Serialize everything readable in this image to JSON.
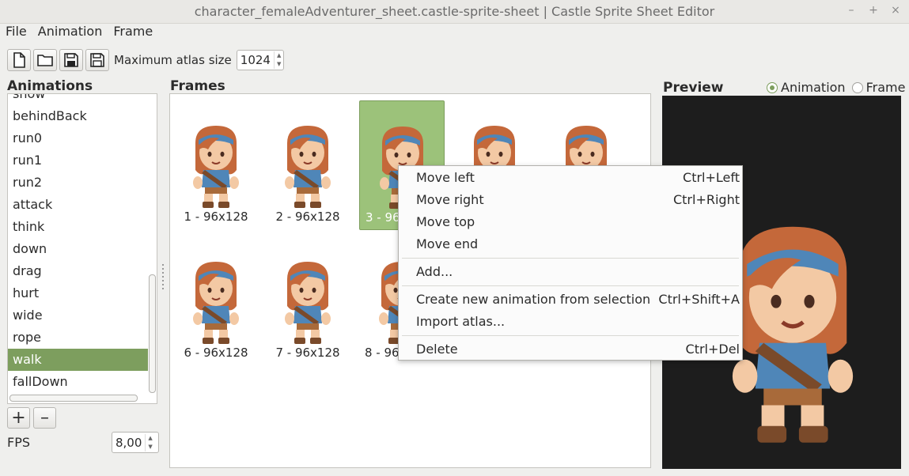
{
  "window": {
    "title": "character_femaleAdventurer_sheet.castle-sprite-sheet | Castle Sprite Sheet Editor",
    "controls": [
      "–",
      "+",
      "×"
    ]
  },
  "menubar": [
    {
      "label": "File"
    },
    {
      "label": "Animation"
    },
    {
      "label": "Frame"
    }
  ],
  "toolbar": {
    "buttons": [
      "new-file-icon",
      "open-folder-icon",
      "save-icon",
      "save-as-icon"
    ],
    "atlas_label": "Maximum atlas size",
    "atlas_value": "1024"
  },
  "animations": {
    "title": "Animations",
    "items": [
      "show",
      "behindBack",
      "run0",
      "run1",
      "run2",
      "attack",
      "think",
      "down",
      "drag",
      "hurt",
      "wide",
      "rope",
      "walk",
      "fallDown"
    ],
    "selected": "walk",
    "add_label": "+",
    "remove_label": "–"
  },
  "fps": {
    "label": "FPS",
    "value": "8,00"
  },
  "frames": {
    "title": "Frames",
    "items": [
      {
        "label": "1 - 96x128"
      },
      {
        "label": "2 - 96x128"
      },
      {
        "label": "3 - 96"
      },
      {
        "label": ""
      },
      {
        "label": ""
      },
      {
        "label": "6 - 96x128"
      },
      {
        "label": "7 - 96x128"
      },
      {
        "label": "8 - 96"
      }
    ],
    "selected_index": 2
  },
  "preview": {
    "title": "Preview",
    "mode_animation": "Animation",
    "mode_frame": "Frame",
    "selected_mode": "Animation"
  },
  "context_menu": {
    "move_left": {
      "label": "Move left",
      "shortcut": "Ctrl+Left"
    },
    "move_right": {
      "label": "Move right",
      "shortcut": "Ctrl+Right"
    },
    "move_top": {
      "label": "Move top",
      "shortcut": ""
    },
    "move_end": {
      "label": "Move end",
      "shortcut": ""
    },
    "add": {
      "label": "Add...",
      "shortcut": ""
    },
    "create_anim": {
      "label": "Create new animation from selection",
      "shortcut": "Ctrl+Shift+A"
    },
    "import_atlas": {
      "label": "Import atlas...",
      "shortcut": ""
    },
    "delete": {
      "label": "Delete",
      "shortcut": "Ctrl+Del"
    }
  },
  "colors": {
    "selection": "#7d9e5e",
    "frame_selection": "#9cc27a",
    "preview_bg": "#1d1d1d"
  }
}
